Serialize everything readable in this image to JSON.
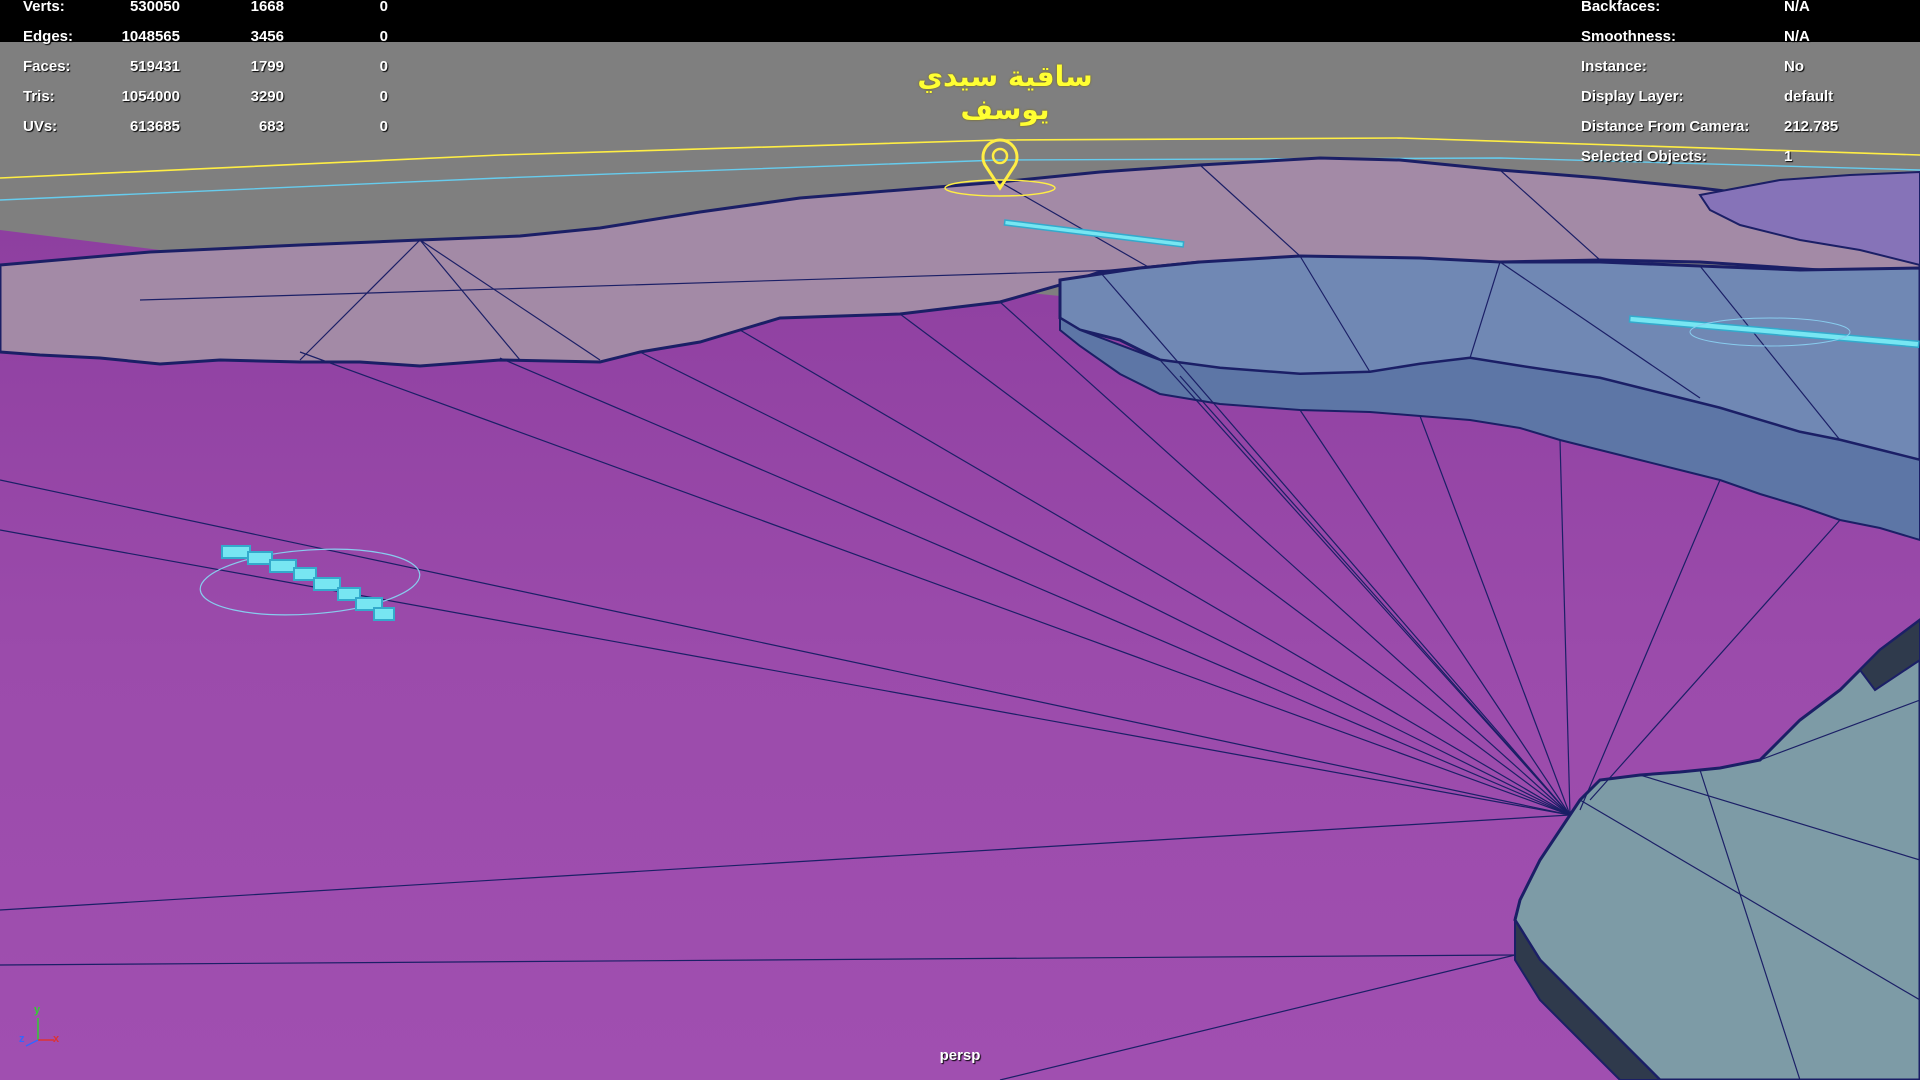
{
  "stats": {
    "rows": [
      {
        "label": "Verts:",
        "v1": "530050",
        "v2": "1668",
        "v3": "0"
      },
      {
        "label": "Edges:",
        "v1": "1048565",
        "v2": "3456",
        "v3": "0"
      },
      {
        "label": "Faces:",
        "v1": "519431",
        "v2": "1799",
        "v3": "0"
      },
      {
        "label": "Tris:",
        "v1": "1054000",
        "v2": "3290",
        "v3": "0"
      },
      {
        "label": "UVs:",
        "v1": "613685",
        "v2": "683",
        "v3": "0"
      }
    ]
  },
  "object_info": {
    "rows": [
      {
        "label": "Backfaces:",
        "value": "N/A"
      },
      {
        "label": "Smoothness:",
        "value": "N/A"
      },
      {
        "label": "Instance:",
        "value": "No"
      },
      {
        "label": "Display Layer:",
        "value": "default"
      },
      {
        "label": "Distance From Camera:",
        "value": "212.785"
      },
      {
        "label": "Selected Objects:",
        "value": "1"
      }
    ]
  },
  "viewport": {
    "camera_name": "persp",
    "place_label": "ساقية سيدي يوسف",
    "axis": {
      "y": "y",
      "z": "z",
      "x": "x"
    }
  },
  "colors": {
    "ground": "#9b4bab",
    "land_pink": "#a38aa6",
    "land_blue": "#7088b4",
    "land_teal": "#7d9ba6",
    "sky_gray": "#7f7f7f",
    "wire": "#1b1f66",
    "marker": "#ffff33",
    "selection": "#66ddee"
  }
}
